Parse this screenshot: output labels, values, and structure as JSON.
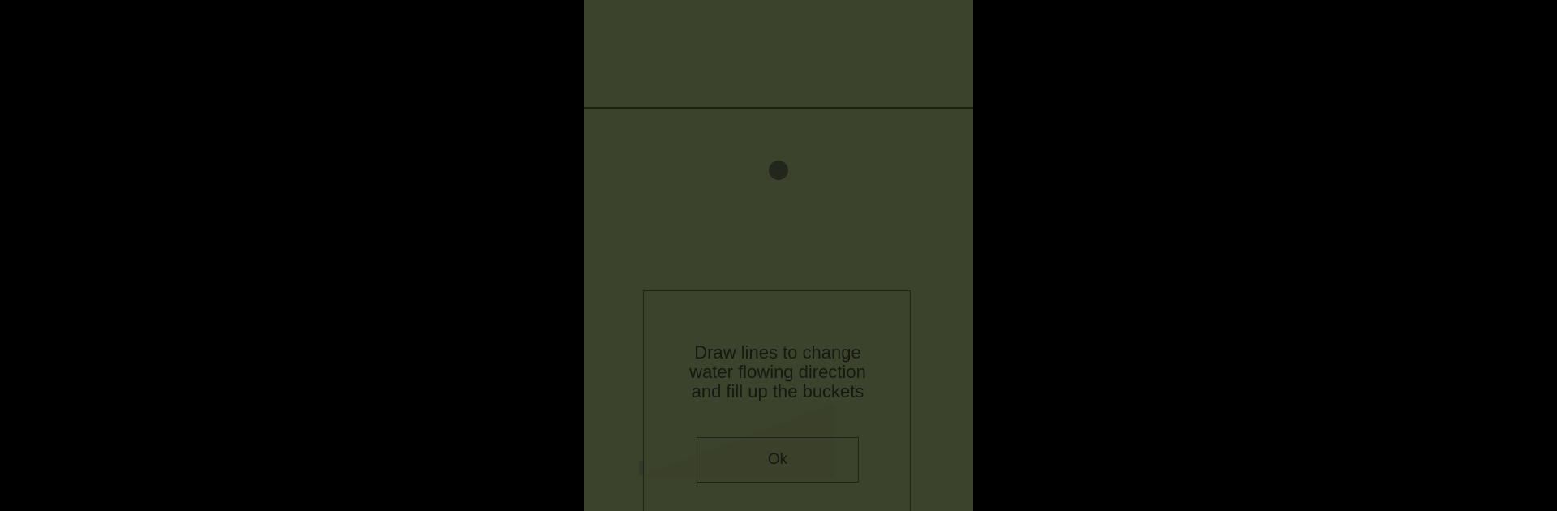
{
  "game": {
    "tutorial": {
      "message": "Draw lines to change\nwater flowing direction\nand fill up the buckets",
      "ok_label": "Ok"
    }
  },
  "colors": {
    "letterbox": "#000000",
    "background": "#3c432d",
    "line": "#1c1f16",
    "text": "#161911"
  }
}
